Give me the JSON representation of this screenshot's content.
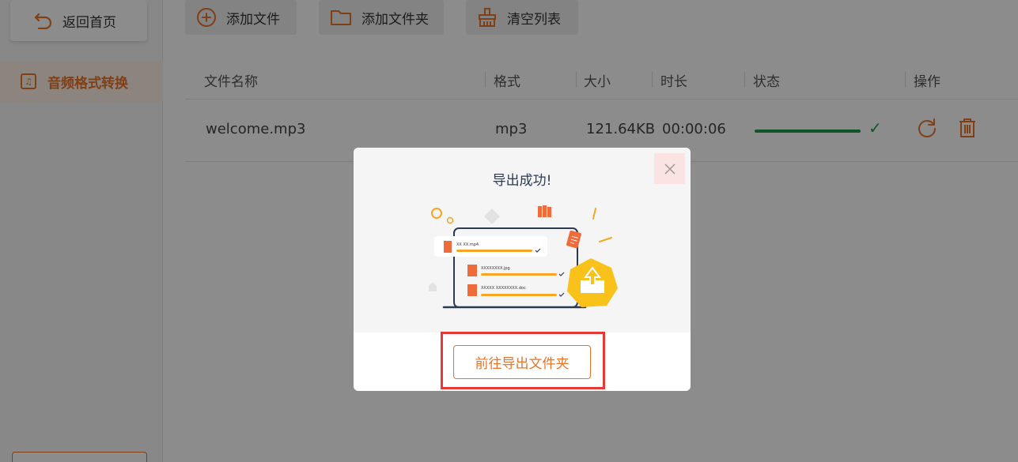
{
  "sidebar": {
    "back_label": "返回首页",
    "nav_item_label": "音频格式转换",
    "nav_icon": "♫"
  },
  "toolbar": {
    "add_file_label": "添加文件",
    "add_folder_label": "添加文件夹",
    "clear_label": "清空列表"
  },
  "table": {
    "headers": {
      "name": "文件名称",
      "format": "格式",
      "size": "大小",
      "duration": "时长",
      "status": "状态",
      "action": "操作"
    },
    "rows": [
      {
        "name": "welcome.mp3",
        "format": "mp3",
        "size": "121.64KB",
        "duration": "00:00:06",
        "progress": 1.0,
        "status_icon": "check-icon"
      }
    ]
  },
  "modal": {
    "title": "导出成功!",
    "button_label": "前往导出文件夹",
    "illustration_files": [
      "XX XX.mp4",
      "XXXXXXXX.jpg",
      "XXXXX XXXXXXXX.doc"
    ]
  },
  "colors": {
    "accent": "#e8742a",
    "success": "#1f9a4e",
    "highlight": "#e53935"
  }
}
